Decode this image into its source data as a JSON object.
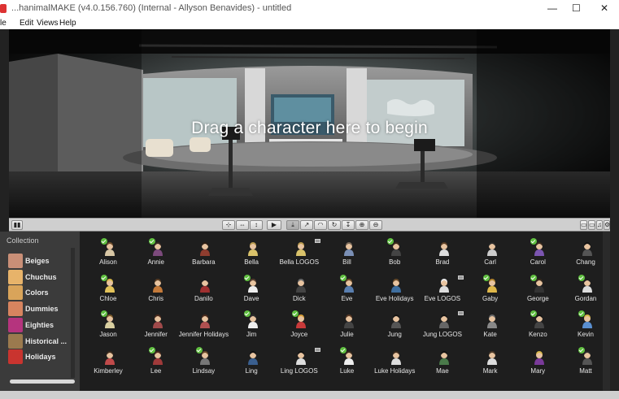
{
  "window": {
    "title": "...hanimalMAKE (v4.0.156.760) (Internal - Allyson Benavides) - untitled",
    "minimize": "—",
    "maximize": "☐",
    "close": "✕"
  },
  "menu": [
    "le",
    "Edit",
    "Views",
    "Help"
  ],
  "stage": {
    "drag_text": "Drag a character here to begin"
  },
  "toolbar": {
    "left_btn": "▮▮",
    "right_btns": [
      "▭",
      "▭",
      "♫",
      "⚙"
    ],
    "buttons": [
      "⊹",
      "⇔",
      "↕",
      "▶",
      "⤓",
      "↗",
      "◠",
      "↻",
      "↧",
      "⊕",
      "⊖"
    ]
  },
  "sidebar": {
    "header": "Collection",
    "items": [
      {
        "label": "Beiges",
        "color": "#c98f77"
      },
      {
        "label": "Chuchus",
        "color": "#e7b36a"
      },
      {
        "label": "Colors",
        "color": "#d9a45a"
      },
      {
        "label": "Dummies",
        "color": "#d7845f"
      },
      {
        "label": "Eighties",
        "color": "#b5347e"
      },
      {
        "label": "Historical ...",
        "color": "#9b7a4e"
      },
      {
        "label": "Holidays",
        "color": "#c9342f"
      }
    ]
  },
  "characters": [
    [
      {
        "name": "Alison",
        "check": true,
        "logo": false,
        "hair": "#6b4a2b",
        "shirt": "#d8c7a5"
      },
      {
        "name": "Annie",
        "check": true,
        "logo": false,
        "hair": "#3a2a22",
        "shirt": "#7c4a7c"
      },
      {
        "name": "Barbara",
        "check": false,
        "logo": false,
        "hair": "#2b1d14",
        "shirt": "#8f3d2f"
      },
      {
        "name": "Bella",
        "check": false,
        "logo": false,
        "hair": "#b99a4e",
        "shirt": "#d9c26a"
      },
      {
        "name": "Bella LOGOS",
        "check": false,
        "logo": true,
        "hair": "#b99a4e",
        "shirt": "#d9c26a"
      },
      {
        "name": "Bill",
        "check": false,
        "logo": false,
        "hair": "#7a6a5a",
        "shirt": "#7a8fb5"
      },
      {
        "name": "Bob",
        "check": true,
        "logo": false,
        "hair": "#3a2a1d",
        "shirt": "#444"
      },
      {
        "name": "Brad",
        "check": false,
        "logo": false,
        "hair": "#5a3e25",
        "shirt": "#ddd"
      },
      {
        "name": "Carl",
        "check": false,
        "logo": false,
        "hair": "#2a2a2a",
        "shirt": "#ccc"
      },
      {
        "name": "Carol",
        "check": true,
        "logo": false,
        "hair": "#3a2a1d",
        "shirt": "#7b55b0"
      },
      {
        "name": "Chang",
        "check": false,
        "logo": false,
        "hair": "#111",
        "shirt": "#555"
      }
    ],
    [
      {
        "name": "Chloe",
        "check": true,
        "logo": false,
        "hair": "#d9b94a",
        "shirt": "#e3c35a"
      },
      {
        "name": "Chris",
        "check": false,
        "logo": false,
        "hair": "#5a3e25",
        "shirt": "#c47a3a"
      },
      {
        "name": "Danilo",
        "check": false,
        "logo": false,
        "hair": "#1d1d1d",
        "shirt": "#a03030"
      },
      {
        "name": "Dave",
        "check": true,
        "logo": false,
        "hair": "#5a4030",
        "shirt": "#eee"
      },
      {
        "name": "Dick",
        "check": false,
        "logo": false,
        "hair": "#6a6a6a",
        "shirt": "#444"
      },
      {
        "name": "Eve",
        "check": true,
        "logo": false,
        "hair": "#6a4b2a",
        "shirt": "#5a7fb0"
      },
      {
        "name": "Eve Holidays",
        "check": false,
        "logo": false,
        "hair": "#6a4b2a",
        "shirt": "#3f6fa0"
      },
      {
        "name": "Eve LOGOS",
        "check": false,
        "logo": true,
        "hair": "#eee",
        "shirt": "#ddd"
      },
      {
        "name": "Gaby",
        "check": true,
        "logo": false,
        "hair": "#b3852e",
        "shirt": "#e0b84a"
      },
      {
        "name": "George",
        "check": true,
        "logo": false,
        "hair": "#3a2a1d",
        "shirt": "#333"
      },
      {
        "name": "Gordan",
        "check": true,
        "logo": false,
        "hair": "#1d1d1d",
        "shirt": "#ddd"
      }
    ],
    [
      {
        "name": "Jason",
        "check": true,
        "logo": false,
        "hair": "#7a5a2a",
        "shirt": "#d9cfa0"
      },
      {
        "name": "Jennifer",
        "check": false,
        "logo": false,
        "hair": "#4a2a1d",
        "shirt": "#a04a4a"
      },
      {
        "name": "Jennifer Holidays",
        "check": false,
        "logo": false,
        "hair": "#4a2a1d",
        "shirt": "#b05050"
      },
      {
        "name": "Jim",
        "check": true,
        "logo": false,
        "hair": "#2a2a2a",
        "shirt": "#eee"
      },
      {
        "name": "Joyce",
        "check": true,
        "logo": false,
        "hair": "#d9a03a",
        "shirt": "#c83a3a"
      },
      {
        "name": "Julie",
        "check": false,
        "logo": false,
        "hair": "#5a3a25",
        "shirt": "#444"
      },
      {
        "name": "Jung",
        "check": false,
        "logo": false,
        "hair": "#111",
        "shirt": "#555"
      },
      {
        "name": "Jung LOGOS",
        "check": false,
        "logo": true,
        "hair": "#111",
        "shirt": "#666"
      },
      {
        "name": "Kate",
        "check": false,
        "logo": false,
        "hair": "#6a6a6a",
        "shirt": "#888"
      },
      {
        "name": "Kenzo",
        "check": true,
        "logo": false,
        "hair": "#111",
        "shirt": "#444"
      },
      {
        "name": "Kevin",
        "check": true,
        "logo": false,
        "hair": "#d9b94a",
        "shirt": "#5a8fd0"
      }
    ],
    [
      {
        "name": "Kimberley",
        "check": false,
        "logo": false,
        "hair": "#3a2a1d",
        "shirt": "#c04a4a"
      },
      {
        "name": "Lee",
        "check": true,
        "logo": false,
        "hair": "#4a2a1d",
        "shirt": "#a03a3a"
      },
      {
        "name": "Lindsay",
        "check": true,
        "logo": false,
        "hair": "#6a4a2a",
        "shirt": "#777"
      },
      {
        "name": "Ling",
        "check": false,
        "logo": false,
        "hair": "#111",
        "shirt": "#3a5f8f"
      },
      {
        "name": "Ling LOGOS",
        "check": false,
        "logo": true,
        "hair": "#111",
        "shirt": "#ddd"
      },
      {
        "name": "Luke",
        "check": true,
        "logo": false,
        "hair": "#3a2a1d",
        "shirt": "#eee"
      },
      {
        "name": "Luke Holidays",
        "check": false,
        "logo": false,
        "hair": "#3a2a1d",
        "shirt": "#ddd"
      },
      {
        "name": "Mae",
        "check": false,
        "logo": false,
        "hair": "#111",
        "shirt": "#4a7a4a"
      },
      {
        "name": "Mark",
        "check": false,
        "logo": false,
        "hair": "#4a3a2a",
        "shirt": "#ddd"
      },
      {
        "name": "Mary",
        "check": false,
        "logo": false,
        "hair": "#d9b94a",
        "shirt": "#7a3a9a"
      },
      {
        "name": "Matt",
        "check": true,
        "logo": false,
        "hair": "#2a2a2a",
        "shirt": "#555"
      }
    ]
  ]
}
